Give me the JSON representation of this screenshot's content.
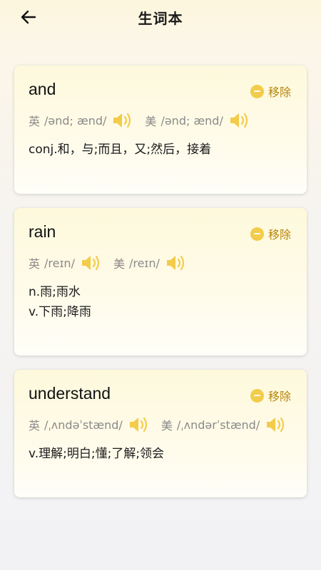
{
  "header": {
    "title": "生词本",
    "back_icon": "arrow-left-icon"
  },
  "colors": {
    "accent": "#f2cc4a",
    "remove_text": "#b8860b",
    "phonetic_text": "#8a8a8a"
  },
  "words": [
    {
      "word": "and",
      "remove_label": "移除",
      "uk_label": "英",
      "uk_phonetic": "/ənd; ænd/",
      "us_label": "美",
      "us_phonetic": "/ənd; ænd/",
      "definitions": [
        "conj.和，与;而且，又;然后，接着"
      ]
    },
    {
      "word": "rain",
      "remove_label": "移除",
      "uk_label": "英",
      "uk_phonetic": "/reɪn/",
      "us_label": "美",
      "us_phonetic": "/reɪn/",
      "definitions": [
        "n.雨;雨水",
        "v.下雨;降雨"
      ]
    },
    {
      "word": "understand",
      "remove_label": "移除",
      "uk_label": "英",
      "uk_phonetic": "/ˌʌndəˈstænd/",
      "us_label": "美",
      "us_phonetic": "/ˌʌndərˈstænd/",
      "definitions": [
        "v.理解;明白;懂;了解;领会"
      ]
    }
  ]
}
